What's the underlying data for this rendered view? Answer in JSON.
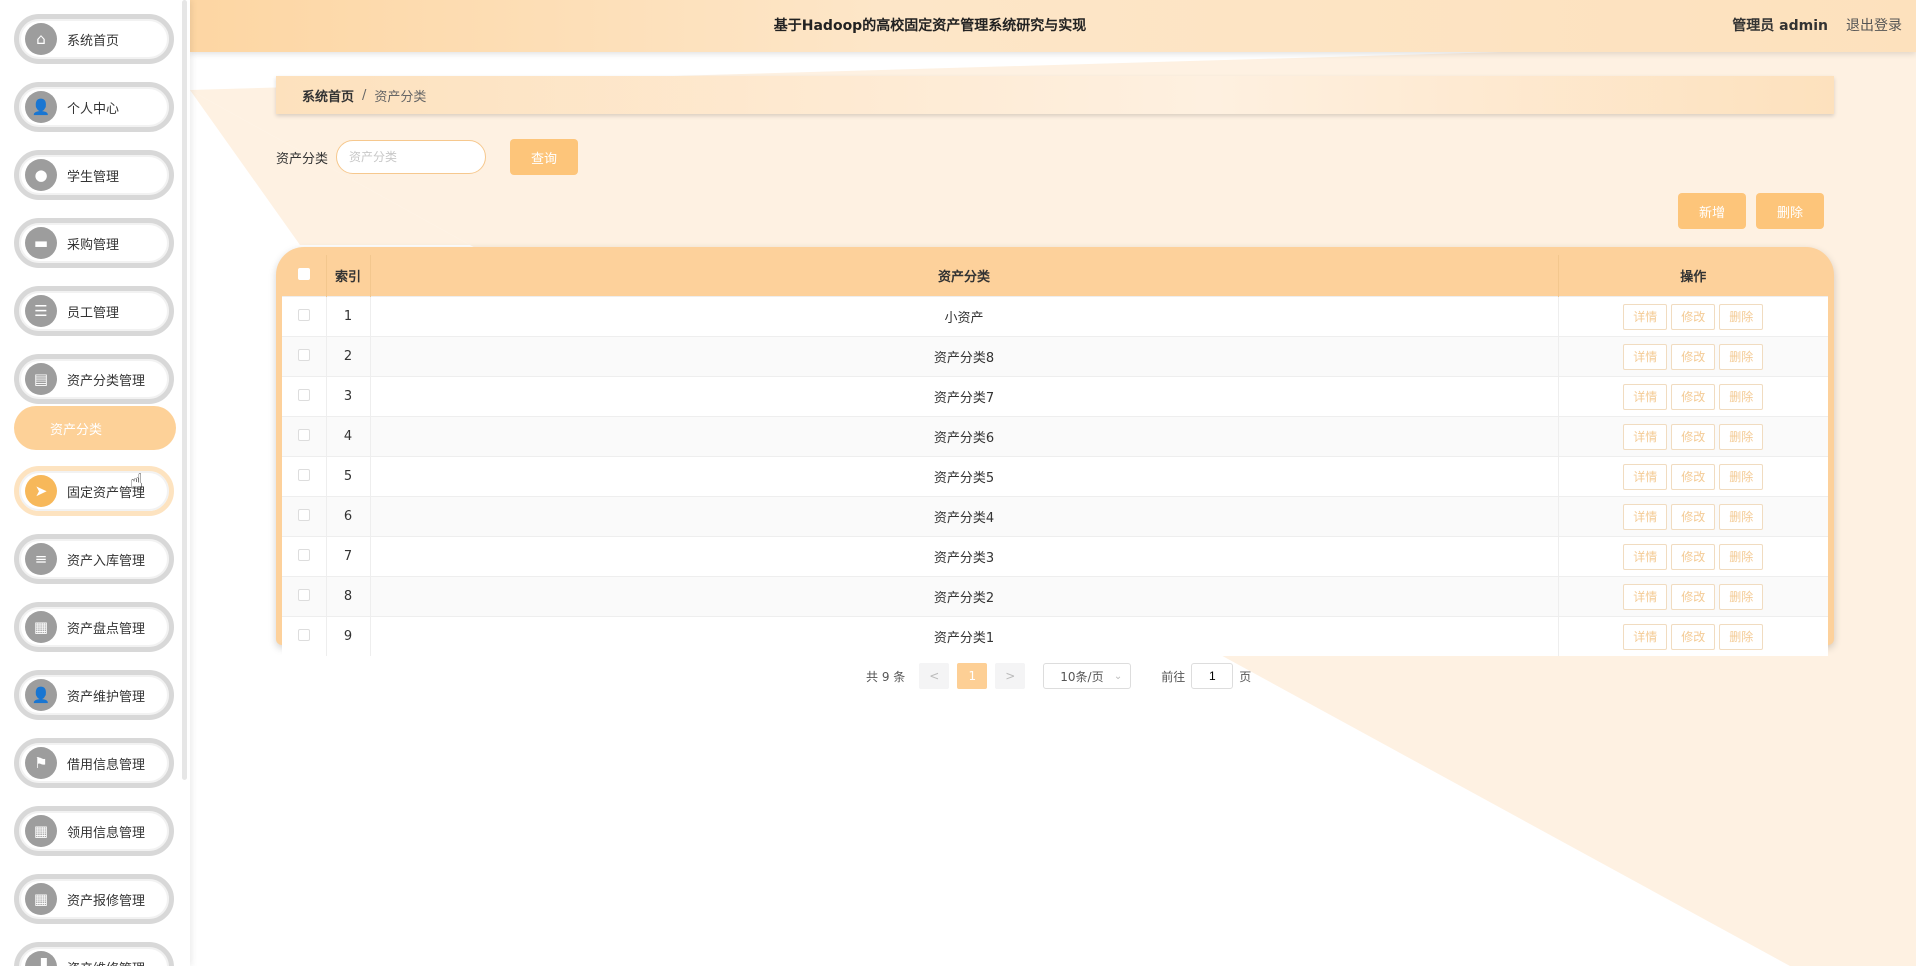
{
  "header": {
    "title": "基于Hadoop的高校固定资产管理系统研究与实现",
    "user": "管理员 admin",
    "logout": "退出登录"
  },
  "sidebar": {
    "items": [
      {
        "label": "系统首页",
        "icon": "home-icon",
        "glyph": "⌂"
      },
      {
        "label": "个人中心",
        "icon": "user-icon",
        "glyph": "👤"
      },
      {
        "label": "学生管理",
        "icon": "location-icon",
        "glyph": "●"
      },
      {
        "label": "采购管理",
        "icon": "briefcase-icon",
        "glyph": "▬"
      },
      {
        "label": "员工管理",
        "icon": "list-icon",
        "glyph": "☰"
      },
      {
        "label": "资产分类管理",
        "icon": "printer-icon",
        "glyph": "▤"
      },
      {
        "label": "固定资产管理",
        "icon": "send-icon",
        "glyph": "➤"
      },
      {
        "label": "资产入库管理",
        "icon": "sliders-icon",
        "glyph": "≡"
      },
      {
        "label": "资产盘点管理",
        "icon": "grid-icon",
        "glyph": "▦"
      },
      {
        "label": "资产维护管理",
        "icon": "user-icon",
        "glyph": "👤"
      },
      {
        "label": "借用信息管理",
        "icon": "flag-icon",
        "glyph": "⚑"
      },
      {
        "label": "领用信息管理",
        "icon": "apps-icon",
        "glyph": "▦"
      },
      {
        "label": "资产报修管理",
        "icon": "grid-icon",
        "glyph": "▦"
      },
      {
        "label": "资产维修管理",
        "icon": "chart-icon",
        "glyph": "▟"
      }
    ],
    "submenu": "资产分类"
  },
  "breadcrumb": {
    "home": "系统首页",
    "sep": "/",
    "current": "资产分类"
  },
  "search": {
    "label": "资产分类",
    "placeholder": "资产分类",
    "button": "查询"
  },
  "actions": {
    "add": "新增",
    "delete": "删除"
  },
  "table": {
    "headers": [
      "索引",
      "资产分类",
      "操作"
    ],
    "rows": [
      {
        "index": "1",
        "name": "小资产"
      },
      {
        "index": "2",
        "name": "资产分类8"
      },
      {
        "index": "3",
        "name": "资产分类7"
      },
      {
        "index": "4",
        "name": "资产分类6"
      },
      {
        "index": "5",
        "name": "资产分类5"
      },
      {
        "index": "6",
        "name": "资产分类4"
      },
      {
        "index": "7",
        "name": "资产分类3"
      },
      {
        "index": "8",
        "name": "资产分类2"
      },
      {
        "index": "9",
        "name": "资产分类1"
      }
    ],
    "ops": [
      "详情",
      "修改",
      "删除"
    ]
  },
  "pagination": {
    "total": "共 9 条",
    "prev": "<",
    "page": "1",
    "next": ">",
    "size": "10条/页",
    "goto_prefix": "前往",
    "goto_value": "1",
    "goto_suffix": "页"
  },
  "colors": {
    "accent": "#fdc57a",
    "header_bg": "#fde1bd",
    "light_bg": "#fef0e0"
  }
}
